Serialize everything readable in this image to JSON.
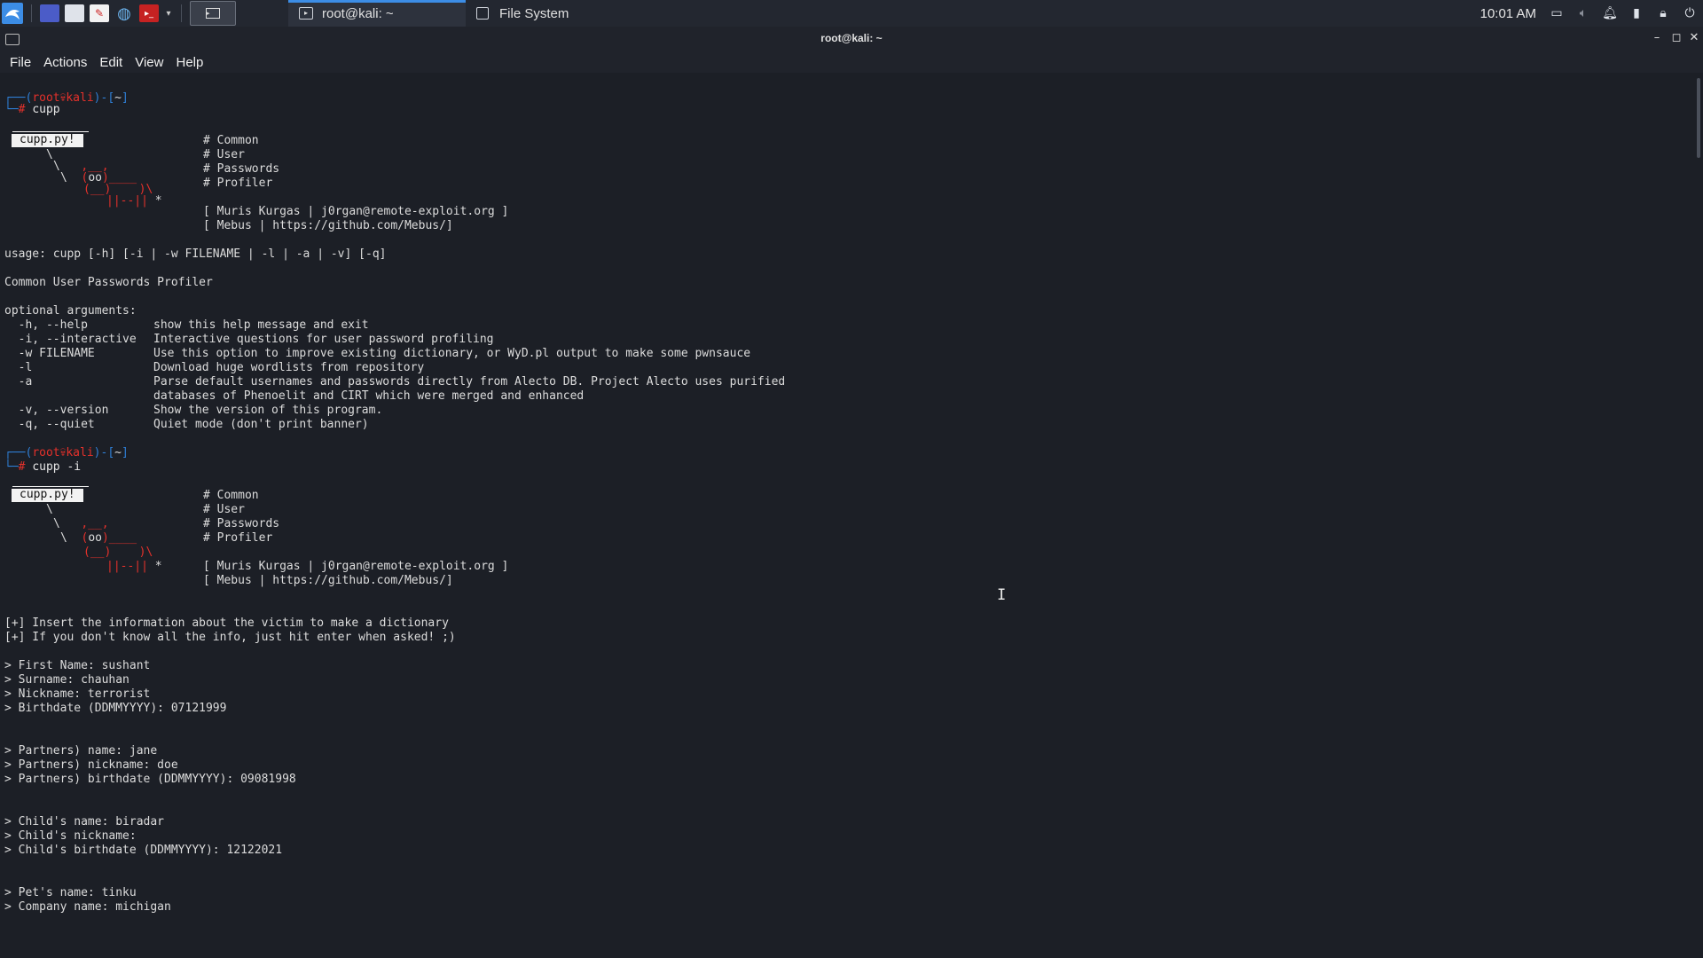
{
  "taskbar": {
    "launchers": [
      {
        "name": "kali-menu-icon",
        "color": "#3c8de6"
      },
      {
        "name": "desktop-icon",
        "color": "#5566cc"
      },
      {
        "name": "file-manager-icon",
        "color": "#e8e8e8"
      },
      {
        "name": "text-editor-icon",
        "color": "#e8e8e8"
      },
      {
        "name": "browser-icon",
        "color": "#5aa9e6"
      },
      {
        "name": "terminal-red-icon",
        "color": "#cc2222"
      }
    ],
    "tasks": [
      {
        "label": "root@kali: ~",
        "active": true
      },
      {
        "label": "File System",
        "active": false
      }
    ],
    "clock": "10:01 AM"
  },
  "window": {
    "title": "root@kali: ~"
  },
  "menu": [
    "File",
    "Actions",
    "Edit",
    "View",
    "Help"
  ],
  "terminal": {
    "prompt1": {
      "user": "root",
      "host": "kali",
      "dir": "~",
      "command": "cupp"
    },
    "banner": {
      "label": "cupp.py!",
      "lines": [
        "# Common",
        "# User",
        "# Passwords",
        "# Profiler"
      ],
      "author": "[ Muris Kurgas | j0rgan@remote-exploit.org ]",
      "contrib": "[ Mebus | https://github.com/Mebus/]"
    },
    "usage": "usage: cupp [-h] [-i | -w FILENAME | -l | -a | -v] [-q]",
    "description": "Common User Passwords Profiler",
    "optional_header": "optional arguments:",
    "options": [
      {
        "flag": "  -h, --help",
        "desc": "show this help message and exit"
      },
      {
        "flag": "  -i, --interactive",
        "desc": "Interactive questions for user password profiling"
      },
      {
        "flag": "  -w FILENAME",
        "desc": "Use this option to improve existing dictionary, or WyD.pl output to make some pwnsauce"
      },
      {
        "flag": "  -l",
        "desc": "Download huge wordlists from repository"
      },
      {
        "flag": "  -a",
        "desc": "Parse default usernames and passwords directly from Alecto DB. Project Alecto uses purified"
      },
      {
        "flag": "",
        "desc": "databases of Phenoelit and CIRT which were merged and enhanced"
      },
      {
        "flag": "  -v, --version",
        "desc": "Show the version of this program."
      },
      {
        "flag": "  -q, --quiet",
        "desc": "Quiet mode (don't print banner)"
      }
    ],
    "prompt2": {
      "user": "root",
      "host": "kali",
      "dir": "~",
      "command": "cupp -i"
    },
    "info": [
      "[+] Insert the information about the victim to make a dictionary",
      "[+] If you don't know all the info, just hit enter when asked! ;)"
    ],
    "answers": [
      "> First Name: sushant",
      "> Surname: chauhan",
      "> Nickname: terrorist",
      "> Birthdate (DDMMYYYY): 07121999",
      "",
      "",
      "> Partners) name: jane",
      "> Partners) nickname: doe",
      "> Partners) birthdate (DDMMYYYY): 09081998",
      "",
      "",
      "> Child's name: biradar",
      "> Child's nickname:",
      "> Child's birthdate (DDMMYYYY): 12122021",
      "",
      "",
      "> Pet's name: tinku",
      "> Company name: michigan"
    ]
  }
}
